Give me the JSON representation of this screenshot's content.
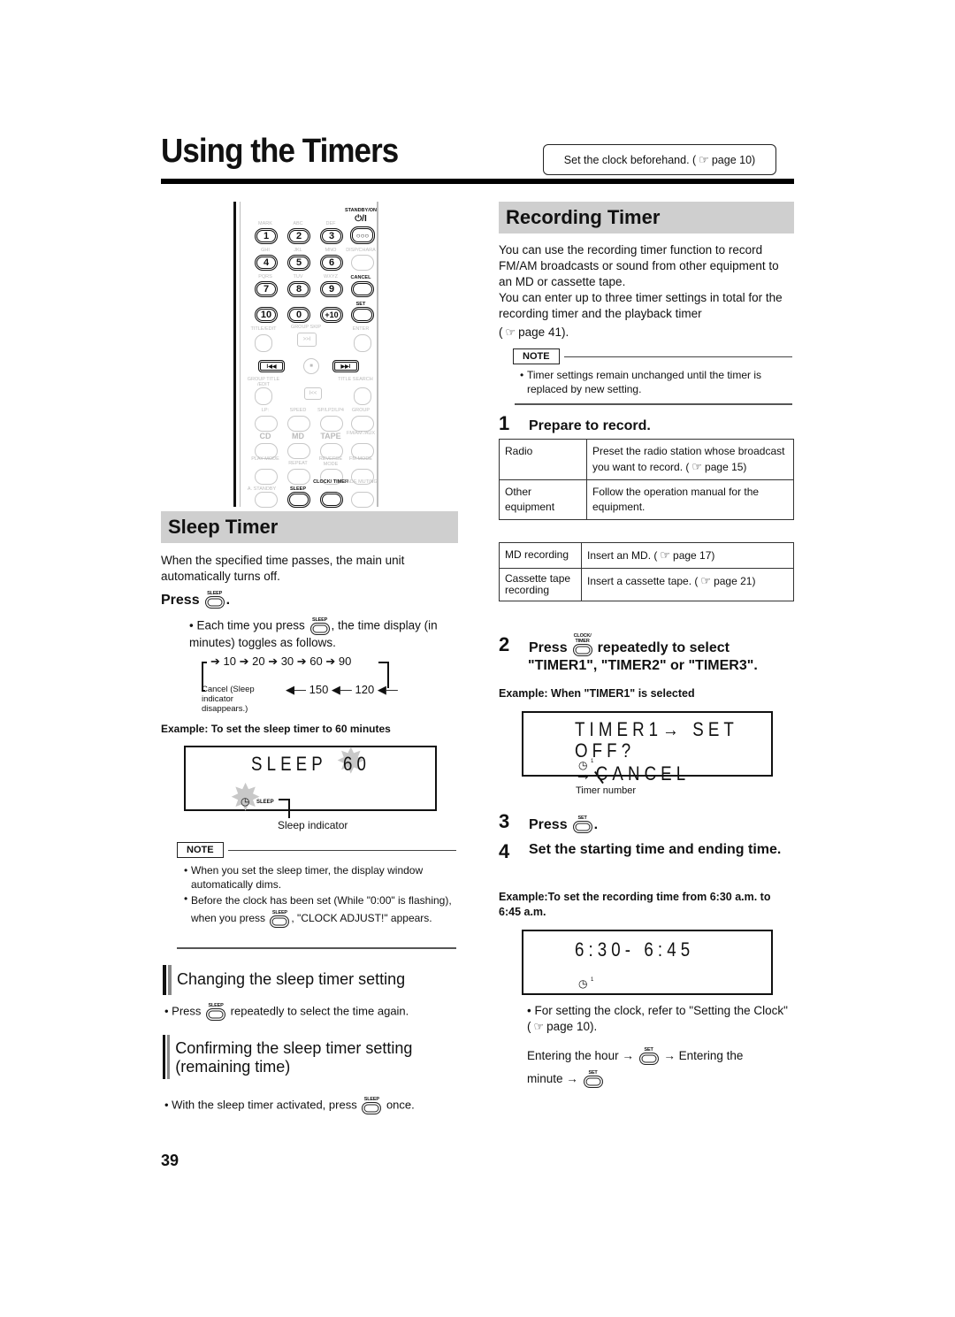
{
  "page": {
    "title": "Using the Timers",
    "top_note": {
      "text": "Set the clock beforehand. (",
      "ref": "page 10)"
    },
    "page_number": "39"
  },
  "icons": {
    "hand": "☞"
  },
  "remote": {
    "standby": "STANDBY/ON",
    "standby_symbol": "⏻/I",
    "number_keys": [
      {
        "key": "1",
        "label": "MARK"
      },
      {
        "key": "2",
        "label": "ABC"
      },
      {
        "key": "3",
        "label": "DEF"
      },
      {
        "key": "4",
        "label": "GHI"
      },
      {
        "key": "5",
        "label": "JKL"
      },
      {
        "key": "6",
        "label": "MNO"
      },
      {
        "key": "7",
        "label": "PQRS"
      },
      {
        "key": "8",
        "label": "TUV"
      },
      {
        "key": "9",
        "label": "WXYZ"
      },
      {
        "key": "10",
        "label": ""
      },
      {
        "key": "0",
        "label": ""
      },
      {
        "key": "+10",
        "label": ""
      }
    ],
    "side_keys": [
      "DISP/CHARA",
      "CANCEL",
      "SET"
    ],
    "labels": {
      "title_edit": "TITLE/EDIT",
      "group_skip": "GROUP SKIP",
      "enter": "ENTER",
      "group_title": "GROUP TITLE /EDIT",
      "title_search": "TITLE SEARCH",
      "lp": "LP:",
      "speed": "SPEED",
      "splp": "SP/LP2/LP4",
      "group": "GROUP",
      "cd": "CD",
      "md": "MD",
      "tape": "TAPE",
      "fmam": "FM/AM /AUX",
      "play_mode": "PLAY MODE",
      "repeat": "REPEAT",
      "reverse_mode": "REVERSE MODE",
      "fm_mode": "FM MODE",
      "a_standby": "A. STANDBY",
      "sleep": "SLEEP",
      "clock_timer": "CLOCK/ TIMER",
      "fade_muting": "FADE MUTING",
      "skip_fwd": "▶▶I",
      "skip_back": "I◀◀",
      "stop": "■",
      "next": ">>I",
      "prev": "I<<"
    }
  },
  "sleep_timer": {
    "heading": "Sleep Timer",
    "intro": "When the specified time passes, the main unit automatically turns off.",
    "press_label": "Press",
    "sleep_btn": "SLEEP",
    "bullet_a": "• Each time you press",
    "bullet_b": ", the time display (in minutes) toggles as follows.",
    "sequence_top": [
      "10",
      "20",
      "30",
      "60",
      "90"
    ],
    "sequence_bottom": [
      "150",
      "120"
    ],
    "cancel_note": "Cancel (Sleep indicator disappears.)",
    "example": "Example: To set the sleep timer to 60 minutes",
    "lcd_text": "SLEEP",
    "lcd_value": "60",
    "lcd_indicator": "SLEEP",
    "indicator_caption": "Sleep indicator",
    "note_label": "NOTE",
    "notes": [
      "When you set the sleep timer, the display window automatically dims.",
      "Before the clock has been set (While \"0:00\" is flashing), when you press"
    ],
    "note2_tail": ", \"CLOCK ADJUST!\" appears.",
    "changing_heading": "Changing the sleep timer setting",
    "changing_a": "• Press",
    "changing_b": "repeatedly to select the time again.",
    "confirming_heading": "Confirming the sleep timer setting (remaining time)",
    "confirming_a": "• With the sleep timer activated, press",
    "confirming_b": "once."
  },
  "recording_timer": {
    "heading": "Recording Timer",
    "intro1": "You can use the recording timer function to record FM/AM broadcasts or sound from other equipment to an MD or cassette tape.",
    "intro2": "You can enter up to three timer settings in total for the recording timer and the playback timer",
    "intro_ref": "page 41).",
    "note_label": "NOTE",
    "note": "Timer settings remain unchanged until the timer is replaced by new setting.",
    "step1_num": "1",
    "step1": "Prepare to record.",
    "table1": [
      {
        "source": "Radio",
        "action": "Preset the radio station whose broadcast you want to record. (",
        "ref": "page 15)"
      },
      {
        "source": "Other equipment",
        "action": "Follow the operation manual for the equipment.",
        "ref": ""
      }
    ],
    "table2": [
      {
        "source": "MD recording",
        "action": "Insert an MD. (",
        "ref": "page 17)"
      },
      {
        "source": "Cassette tape recording",
        "action": "Insert a cassette tape. (",
        "ref": "page 21)"
      }
    ],
    "step2_num": "2",
    "step2_a": "Press",
    "step2_btn": "CLOCK/ TIMER",
    "step2_b": "repeatedly to select",
    "step2_c": "\"TIMER1\", \"TIMER2\" or \"TIMER3\".",
    "example2": "Example: When \"TIMER1\" is selected",
    "lcd2_line1": "TIMER1→ SET",
    "lcd2_line2": "OFF?→CANCEL",
    "timer_sup": "1",
    "timer_caption": "Timer number",
    "step3_num": "3",
    "step3": "Press",
    "set_btn": "SET",
    "step4_num": "4",
    "step4": "Set the starting time and ending time.",
    "example4": "Example:To set the recording time from 6:30 a.m. to 6:45 a.m.",
    "lcd3_text": "6:30- 6:45",
    "bullet_clock": "• For setting the clock, refer to \"Setting the Clock\" (",
    "bullet_clock_ref": "page 10).",
    "enter_hour": "Entering the hour →",
    "enter_minute_a": "→ Entering the",
    "enter_minute_b": "minute →"
  }
}
